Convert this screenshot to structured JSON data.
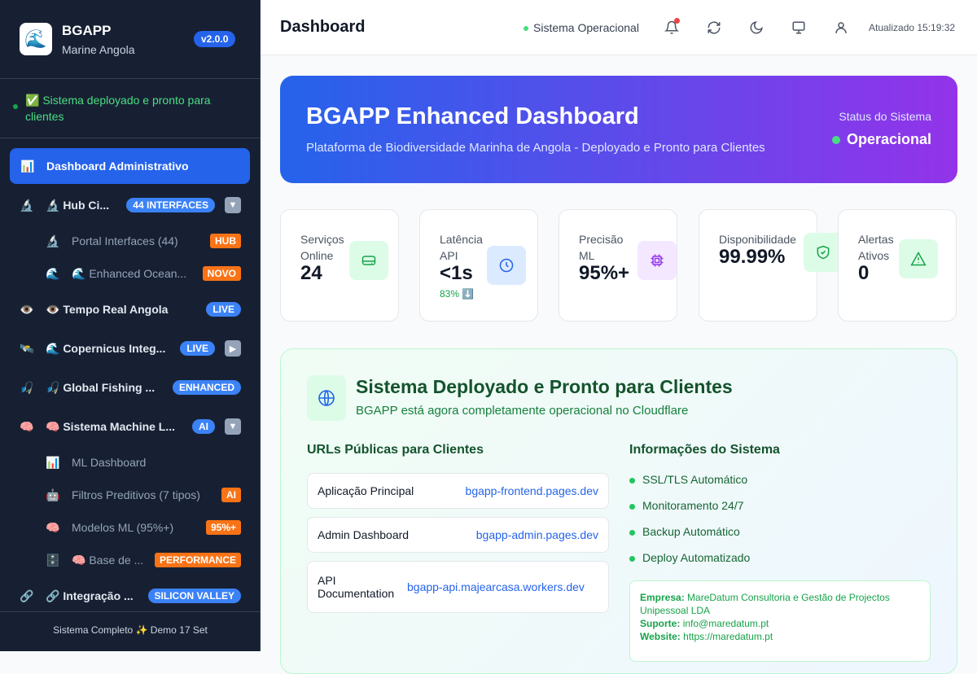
{
  "sidebar": {
    "logo_emoji": "🌊",
    "title": "BGAPP",
    "subtitle": "Marine Angola",
    "version": "v2.0.0",
    "deploy_status": "✅ Sistema deployado e pronto para clientes",
    "active": {
      "emoji": "📊",
      "label": "Dashboard Administrativo"
    },
    "items": [
      {
        "e1": "🔬",
        "label": "🔬 Hub Ci...",
        "badge": "44 INTERFACES",
        "arrow": "▼"
      },
      {
        "e1": "🔬",
        "label": "Portal Interfaces (44)",
        "badge": "HUB",
        "sub": true
      },
      {
        "e1": "🌊",
        "label": "🌊 Enhanced Ocean...",
        "badge": "NOVO",
        "sub": true
      },
      {
        "e1": "👁️",
        "label": "👁️ Tempo Real Angola",
        "badge": "LIVE"
      },
      {
        "e1": "🛰️",
        "label": "🌊 Copernicus Integ...",
        "badge": "LIVE",
        "arrow": "▶"
      },
      {
        "e1": "🎣",
        "label": "🎣 Global Fishing ...",
        "badge": "ENHANCED"
      },
      {
        "e1": "🧠",
        "label": "🧠 Sistema Machine L...",
        "badge": "AI",
        "arrow": "▼"
      },
      {
        "e1": "📊",
        "label": "ML Dashboard",
        "badge": "",
        "sub": true
      },
      {
        "e1": "🤖",
        "label": "Filtros Preditivos (7 tipos)",
        "badge": "AI",
        "sub": true
      },
      {
        "e1": "🧠",
        "label": "Modelos ML (95%+)",
        "badge": "95%+",
        "sub": true
      },
      {
        "e1": "🗄️",
        "label": "🧠 Base de ...",
        "badge": "PERFORMANCE",
        "sub": true
      },
      {
        "e1": "🔗",
        "label": "🔗 Integração ...",
        "badge": "SILICON VALLEY"
      }
    ],
    "footer": "Sistema Completo ✨ Demo 17 Set"
  },
  "header": {
    "title": "Dashboard",
    "status": "Sistema Operacional",
    "updated": "Atualizado 15:19:32",
    "icons": [
      "bell-icon",
      "refresh-icon",
      "moon-icon",
      "monitor-icon",
      "user-icon"
    ]
  },
  "hero": {
    "title": "BGAPP Enhanced Dashboard",
    "subtitle": "Plataforma de Biodiversidade Marinha de Angola - Deployado e Pronto para Clientes",
    "status_label": "Status do Sistema",
    "status_value": "Operacional"
  },
  "cards": [
    {
      "label": "Serviços Online",
      "value": "24",
      "icon": "server-icon",
      "color": "#16a34a",
      "bg": "#dcfce7"
    },
    {
      "label": "Latência API",
      "value": "<1s",
      "trend": "83% ⬇️",
      "icon": "clock-icon",
      "color": "#2563eb",
      "bg": "#dbeafe"
    },
    {
      "label": "Precisão ML",
      "value": "95%+",
      "icon": "cpu-icon",
      "color": "#9333ea",
      "bg": "#f3e8ff"
    },
    {
      "label": "Disponibilidade",
      "value": "99.99%",
      "icon": "shield-check-icon",
      "color": "#16a34a",
      "bg": "#dcfce7"
    },
    {
      "label": "Alertas Ativos",
      "value": "0",
      "icon": "alert-triangle-icon",
      "color": "#16a34a",
      "bg": "#dcfce7"
    }
  ],
  "deploy": {
    "title": "Sistema Deployado e Pronto para Clientes",
    "subtitle": "BGAPP está agora completamente operacional no Cloudflare",
    "urls_title": "URLs Públicas para Clientes",
    "urls": [
      {
        "name": "Aplicação Principal",
        "url": "bgapp-frontend.pages.dev"
      },
      {
        "name": "Admin Dashboard",
        "url": "bgapp-admin.pages.dev"
      },
      {
        "name": "API Documentation",
        "url": "bgapp-api.majearcasa.workers.dev"
      }
    ],
    "info_title": "Informações do Sistema",
    "info": [
      "SSL/TLS Automático",
      "Monitoramento 24/7",
      "Backup Automático",
      "Deploy Automatizado"
    ],
    "company_label": "Empresa:",
    "company": "MareDatum Consultoria e Gestão de Projectos Unipessoal LDA",
    "support_label": "Suporte:",
    "support": "info@maredatum.pt",
    "website_label": "Website:",
    "website": "https://maredatum.pt"
  }
}
